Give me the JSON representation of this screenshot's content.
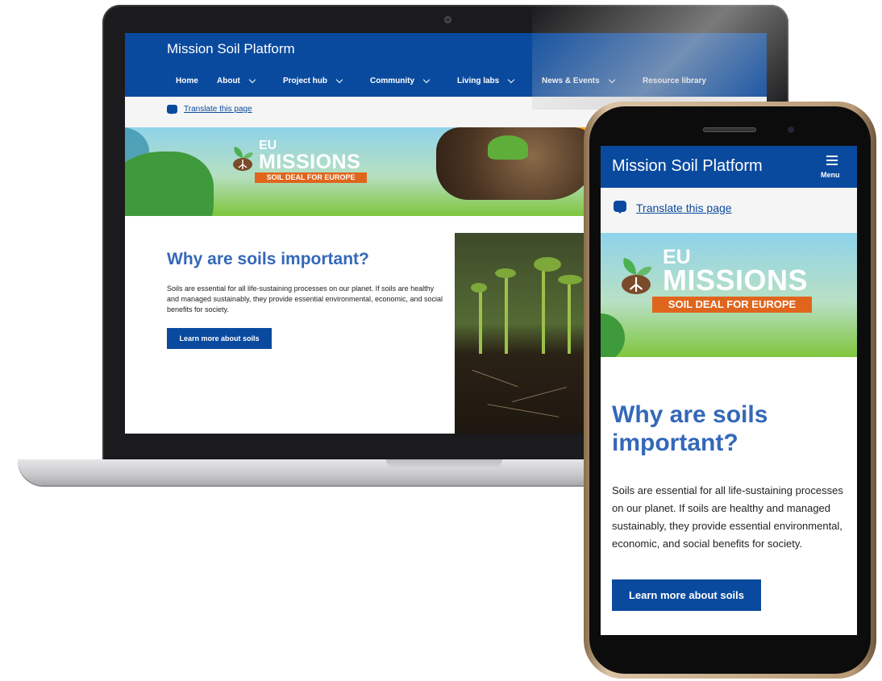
{
  "desktop": {
    "site_title": "Mission Soil Platform",
    "nav": [
      {
        "label": "Home",
        "has_dropdown": false
      },
      {
        "label": "About",
        "has_dropdown": true
      },
      {
        "label": "Project hub",
        "has_dropdown": true
      },
      {
        "label": "Community",
        "has_dropdown": true
      },
      {
        "label": "Living labs",
        "has_dropdown": true
      },
      {
        "label": "News & Events",
        "has_dropdown": true
      },
      {
        "label": "Resource library",
        "has_dropdown": false
      }
    ],
    "translate_link": "Translate this page",
    "banner": {
      "eu": "EU",
      "missions": "MISSIONS",
      "deal": "SOIL DEAL FOR EUROPE"
    },
    "heading": "Why are soils important?",
    "paragraph": "Soils are essential for all life-sustaining processes on our planet. If soils are healthy and managed sustainably, they provide essential environmental, economic, and social benefits for society.",
    "button": "Learn more about soils"
  },
  "mobile": {
    "site_title": "Mission Soil Platform",
    "menu_label": "Menu",
    "translate_link": "Translate this page",
    "banner": {
      "eu": "EU",
      "missions": "MISSIONS",
      "deal": "SOIL DEAL FOR EUROPE"
    },
    "heading": "Why are soils important?",
    "paragraph": "Soils are essential for all life-sustaining processes on our planet. If soils are healthy and managed sustainably, they provide essential environmental, economic, and social benefits for society.",
    "button": "Learn more about soils"
  },
  "colors": {
    "brand_blue": "#0a4a9e",
    "heading_blue": "#3468b8",
    "deal_orange": "#e0651c"
  }
}
